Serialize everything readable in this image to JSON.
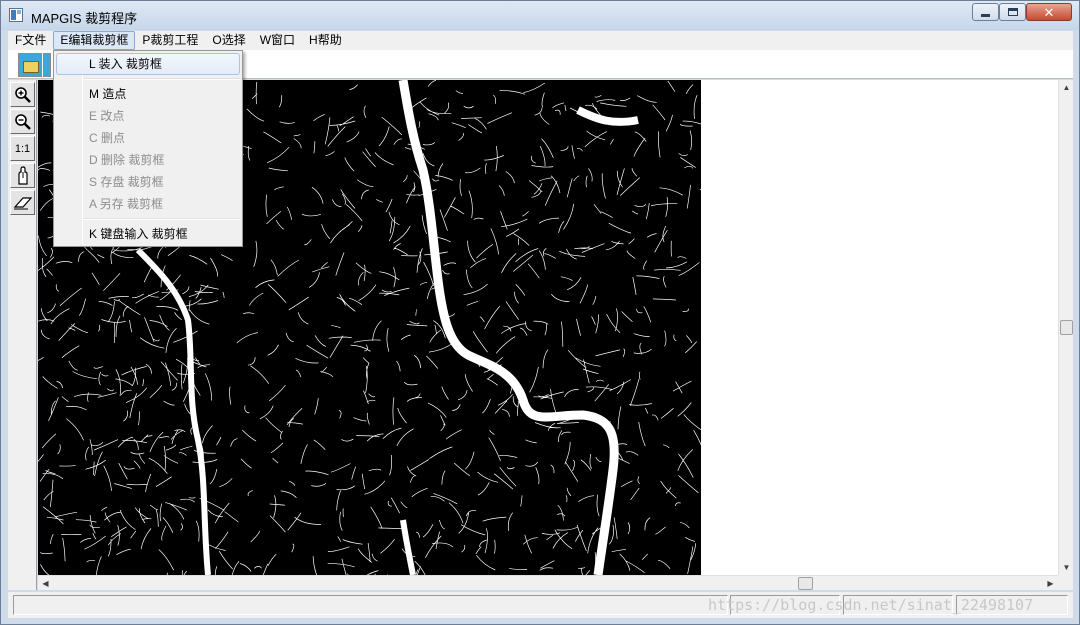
{
  "window": {
    "title": "MAPGIS 裁剪程序",
    "close_glyph": "✕"
  },
  "menubar": {
    "items": [
      {
        "label": "F文件"
      },
      {
        "label": "E编辑裁剪框"
      },
      {
        "label": "P裁剪工程"
      },
      {
        "label": "O选择"
      },
      {
        "label": "W窗口"
      },
      {
        "label": "H帮助"
      }
    ]
  },
  "edit_menu": {
    "items": [
      {
        "label": "L 装入 裁剪框",
        "enabled": true,
        "highlighted": true
      },
      {
        "label": "M 造点",
        "enabled": true
      },
      {
        "label": "E 改点",
        "enabled": false
      },
      {
        "label": "C 删点",
        "enabled": false
      },
      {
        "label": "D 删除 裁剪框",
        "enabled": false
      },
      {
        "label": "S 存盘 裁剪框",
        "enabled": false
      },
      {
        "label": "A 另存 裁剪框",
        "enabled": false
      },
      {
        "label": "K 键盘输入 裁剪框",
        "enabled": true
      }
    ]
  },
  "toolstrip": {
    "tools": [
      {
        "icon": "zoom-in-icon"
      },
      {
        "icon": "zoom-out-icon"
      },
      {
        "icon": "actual-size-icon",
        "label": "1:1"
      },
      {
        "icon": "pan-icon"
      },
      {
        "icon": "eraser-icon"
      }
    ]
  },
  "map": {
    "description_icon": "contour-map-image"
  },
  "statusbar": {
    "watermark": "https://blog.csdn.net/sinat_22498107"
  }
}
